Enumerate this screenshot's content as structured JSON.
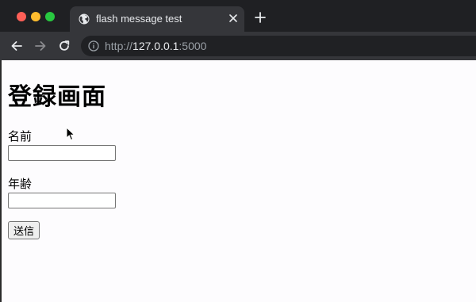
{
  "browser": {
    "tab": {
      "title": "flash message test",
      "favicon": "globe-icon",
      "close_icon": "close-icon"
    },
    "new_tab_icon": "plus-icon",
    "nav": {
      "back_icon": "arrow-left-icon",
      "forward_icon": "arrow-right-icon",
      "reload_icon": "reload-icon"
    },
    "address_bar": {
      "security_icon": "info-icon",
      "scheme": "http://",
      "host": "127.0.0.1",
      "port": ":5000"
    },
    "colors": {
      "tabstrip": "#1f2023",
      "active_tab": "#35363a",
      "omnibox": "#202124",
      "close": "#fe5f57",
      "minimize": "#febc2e",
      "maximize": "#28c840"
    }
  },
  "page": {
    "title": "登録画面",
    "form": {
      "name_label": "名前",
      "name_value": "",
      "age_label": "年齢",
      "age_value": "",
      "submit_label": "送信"
    }
  }
}
